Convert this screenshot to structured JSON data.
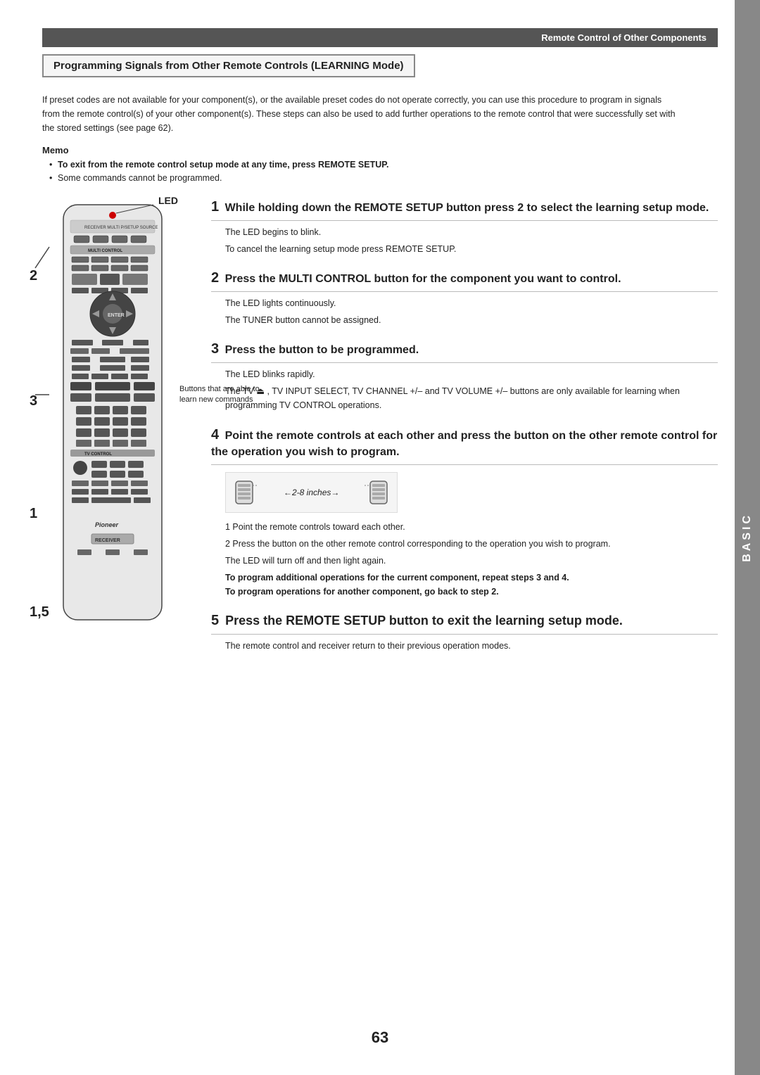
{
  "header": {
    "section_label": "Remote Control of Other Components"
  },
  "title": {
    "text": "Programming Signals from Other Remote Controls (LEARNING Mode)"
  },
  "intro": {
    "text": "If preset codes are not available for your component(s), or the available preset codes do not operate correctly, you can use this procedure to program in signals from the remote control(s) of your other component(s). These steps can also be used to add further operations to the remote control that were successfully set with the stored settings (see page 62)."
  },
  "memo": {
    "title": "Memo",
    "items": [
      {
        "bold": true,
        "text": "To exit from the remote control setup mode at any time, press REMOTE SETUP."
      },
      {
        "bold": false,
        "text": "Some commands cannot be programmed."
      }
    ]
  },
  "remote": {
    "labels": {
      "led": "LED",
      "num2": "2",
      "num3": "3",
      "num1": "1",
      "num15": "1,5",
      "buttons_caption": "Buttons that are able to learn new commands"
    }
  },
  "steps": [
    {
      "number": "1",
      "heading": "While holding down the REMOTE SETUP button press 2 to select the learning setup mode.",
      "body": [
        "The LED begins to blink.",
        "To cancel the learning setup mode press REMOTE SETUP."
      ]
    },
    {
      "number": "2",
      "heading": "Press the MULTI CONTROL button for the component you want to control.",
      "body": [
        "The LED lights continuously.",
        "The TUNER button cannot be assigned."
      ]
    },
    {
      "number": "3",
      "heading": "Press the button to be programmed.",
      "body": [
        "The LED blinks rapidly.",
        "The TV \u0000, TV INPUT SELECT, TV CHANNEL +/– and TV VOLUME +/– buttons are only available for learning when programming TV CONTROL operations."
      ]
    },
    {
      "number": "4",
      "heading": "Point the remote controls at each other and press the button on the other remote control for the operation you wish to program.",
      "diagram": {
        "arrow_text": "←2-8 inches→"
      },
      "notes": [
        "1  Point the remote controls toward each other.",
        "2  Press the button on the other remote control corresponding to the operation you wish to program."
      ],
      "led_note": "The LED will turn off and then light again.",
      "bold_instructions": [
        "To program additional operations for the current component, repeat steps 3 and 4.",
        "To program operations for another component, go back to step 2."
      ]
    },
    {
      "number": "5",
      "heading": "Press the REMOTE SETUP button to exit the learning setup mode.",
      "body": [
        "The remote control and receiver return to their previous operation modes."
      ]
    }
  ],
  "page_number": "63",
  "basic_label": "BASIC"
}
